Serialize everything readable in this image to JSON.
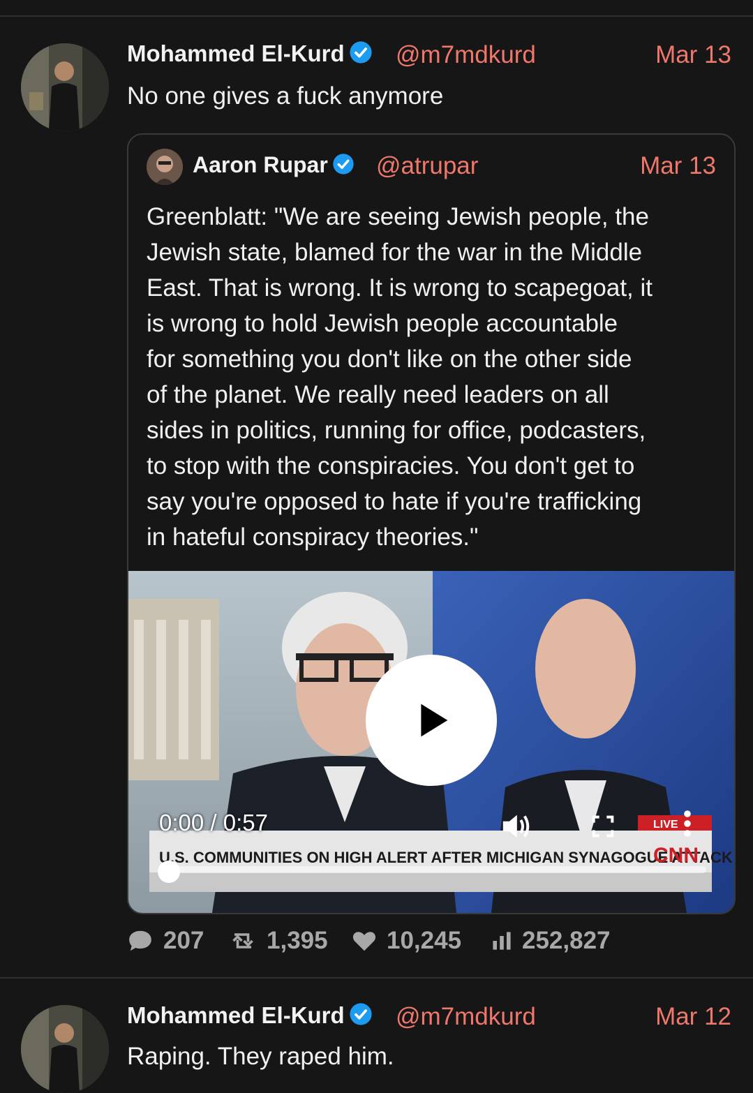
{
  "tweets": [
    {
      "author": "Mohammed El-Kurd",
      "handle": "@m7mdkurd",
      "date": "Mar 13",
      "text": "No one gives a fuck anymore",
      "quote": {
        "author": "Aaron Rupar",
        "handle": "@atrupar",
        "date": "Mar 13",
        "lines": [
          "Greenblatt: \"We are seeing Jewish people, the",
          "Jewish state, blamed for the war in the Middle",
          "East. That is wrong. It is wrong to scapegoat, it",
          "is wrong to hold Jewish people accountable",
          "for something you don't like on the other side",
          "of the planet. We really need leaders on all",
          "sides in politics, running for office, podcasters,",
          "to stop with the conspiracies. You don't get to",
          "say you're opposed to hate if you're trafficking",
          "in hateful conspiracy theories.\""
        ],
        "video": {
          "time": "0:00 / 0:57",
          "progress": 0,
          "chyron": "U.S. COMMUNITIES ON HIGH ALERT AFTER MICHIGAN SYNAGOGUE ATTACK",
          "live_label": "LIVE",
          "network": "CNN"
        }
      },
      "stats": {
        "replies": "207",
        "retweets": "1,395",
        "likes": "10,245",
        "views": "252,827"
      }
    },
    {
      "author": "Mohammed El-Kurd",
      "handle": "@m7mdkurd",
      "date": "Mar 12",
      "text": "Raping. They raped him."
    }
  ],
  "colors": {
    "background": "#161616",
    "accent": "#f0776b",
    "verified": "#1d9bf0",
    "stat": "#a8a8a8"
  },
  "icons": [
    "verified-badge-icon",
    "play-icon",
    "volume-icon",
    "fullscreen-icon",
    "more-icon",
    "reply-icon",
    "retweet-icon",
    "like-icon",
    "views-icon"
  ]
}
